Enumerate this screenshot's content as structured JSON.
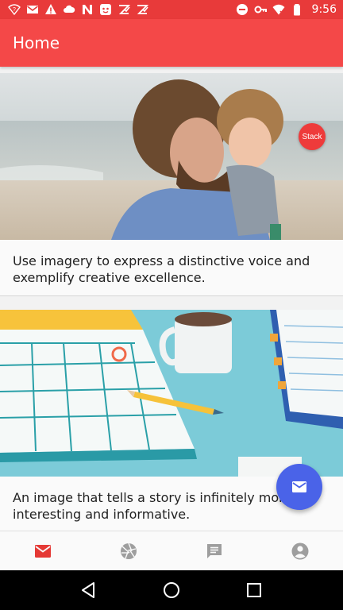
{
  "status_bar": {
    "time": "9:56",
    "left_icons": [
      "wifi-question-icon",
      "gmail-icon",
      "warning-icon",
      "cloud-icon",
      "n-icon",
      "bot-icon",
      "check-icon",
      "check-icon"
    ],
    "right_icons": [
      "dnd-icon",
      "key-icon",
      "wifi-icon",
      "battery-icon"
    ]
  },
  "app_bar": {
    "title": "Home"
  },
  "cards": [
    {
      "image": "father-and-child-photo",
      "badge": "Stack",
      "text": "Use imagery to express a distinctive voice and exemplify creative excellence."
    },
    {
      "image": "calendar-desk-illustration",
      "text": "An image that tells a story is infinitely more interesting and informative."
    }
  ],
  "fab": {
    "icon": "mail-icon"
  },
  "bottom_nav": {
    "items": [
      {
        "icon": "mail-icon",
        "active": true
      },
      {
        "icon": "camera-aperture-icon",
        "active": false
      },
      {
        "icon": "chat-icon",
        "active": false
      },
      {
        "icon": "account-icon",
        "active": false
      }
    ]
  },
  "colors": {
    "status_bar": "#e83a3a",
    "app_bar": "#f44848",
    "fab": "#4a63e8",
    "nav_active": "#e53935",
    "nav_inactive": "#9e9e9e"
  }
}
